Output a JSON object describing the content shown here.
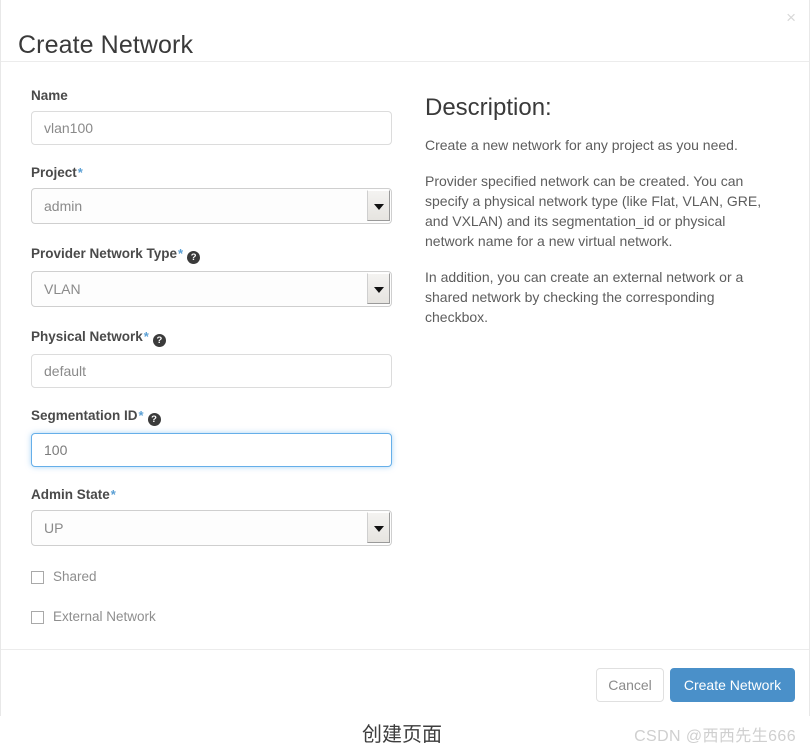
{
  "dialog": {
    "title": "Create Network",
    "close_label": "×"
  },
  "form": {
    "name": {
      "label": "Name",
      "required": false,
      "value": "vlan100",
      "placeholder": "vlan100"
    },
    "project": {
      "label": "Project",
      "required_marker": "*",
      "value": "admin"
    },
    "provider_network_type": {
      "label": "Provider Network Type",
      "required_marker": "*",
      "help": "?",
      "value": "VLAN"
    },
    "physical_network": {
      "label": "Physical Network",
      "required_marker": "*",
      "help": "?",
      "value": "default",
      "placeholder": "default"
    },
    "segmentation_id": {
      "label": "Segmentation ID",
      "required_marker": "*",
      "help": "?",
      "value": "100",
      "placeholder": "100"
    },
    "admin_state": {
      "label": "Admin State",
      "required_marker": "*",
      "value": "UP"
    },
    "shared": {
      "label": "Shared",
      "checked": false
    },
    "external_network": {
      "label": "External Network",
      "checked": false
    }
  },
  "description": {
    "heading": "Description:",
    "paragraphs": [
      "Create a new network for any project as you need.",
      "Provider specified network can be created. You can specify a physical network type (like Flat, VLAN, GRE, and VXLAN) and its segmentation_id or physical network name for a new virtual network.",
      "In addition, you can create an external network or a shared network by checking the corresponding checkbox."
    ],
    "p0": "Create a new network for any project as you need.",
    "p1": "Provider specified network can be created. You can specify a physical network type (like Flat, VLAN, GRE, and VXLAN) and its segmentation_id or physical network name for a new virtual network.",
    "p2": "In addition, you can create an external network or a shared network by checking the corresponding checkbox."
  },
  "footer": {
    "cancel_label": "Cancel",
    "submit_label": "Create Network"
  },
  "annotations": {
    "caption": "创建页面",
    "watermark": "CSDN @西西先生666"
  },
  "colors": {
    "primary_button": "#4a90c9",
    "required_star": "#5a9fd4",
    "focus_border": "#66afe9",
    "label_text": "#4a4a4a",
    "input_text": "#8a8a8a"
  }
}
